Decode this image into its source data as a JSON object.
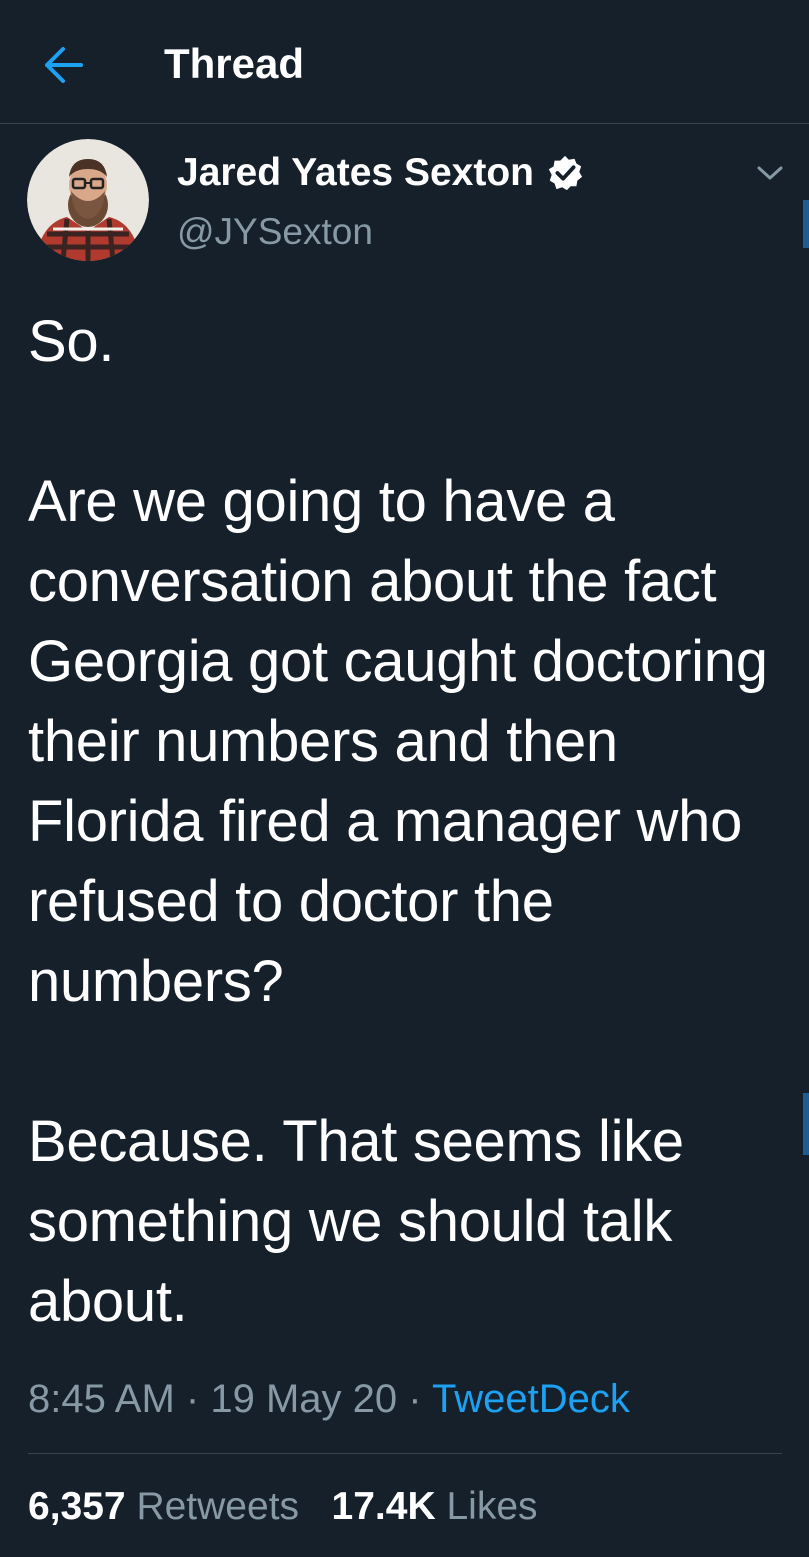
{
  "header": {
    "title": "Thread",
    "back_icon": "arrow-left-icon",
    "accent_color": "#1da1f2"
  },
  "tweet": {
    "author": {
      "name": "Jared Yates Sexton",
      "handle": "@JYSexton",
      "verified": true
    },
    "text": {
      "p1": "So.",
      "p2": "Are we going to have a conversation about the fact Georgia got caught doctoring their numbers and then Florida fired a manager who refused to doctor the numbers?",
      "p3": "Because. That seems like something we should talk about."
    },
    "time": "8:45 AM",
    "separator": "·",
    "date": "19 May 20",
    "source": "TweetDeck",
    "stats": {
      "retweets_count": "6,357",
      "retweets_label": "Retweets",
      "likes_count": "17.4K",
      "likes_label": "Likes"
    }
  },
  "colors": {
    "background": "#15202b",
    "text_primary": "#ffffff",
    "text_secondary": "#8899a6",
    "divider": "#38444d",
    "link": "#1da1f2"
  }
}
